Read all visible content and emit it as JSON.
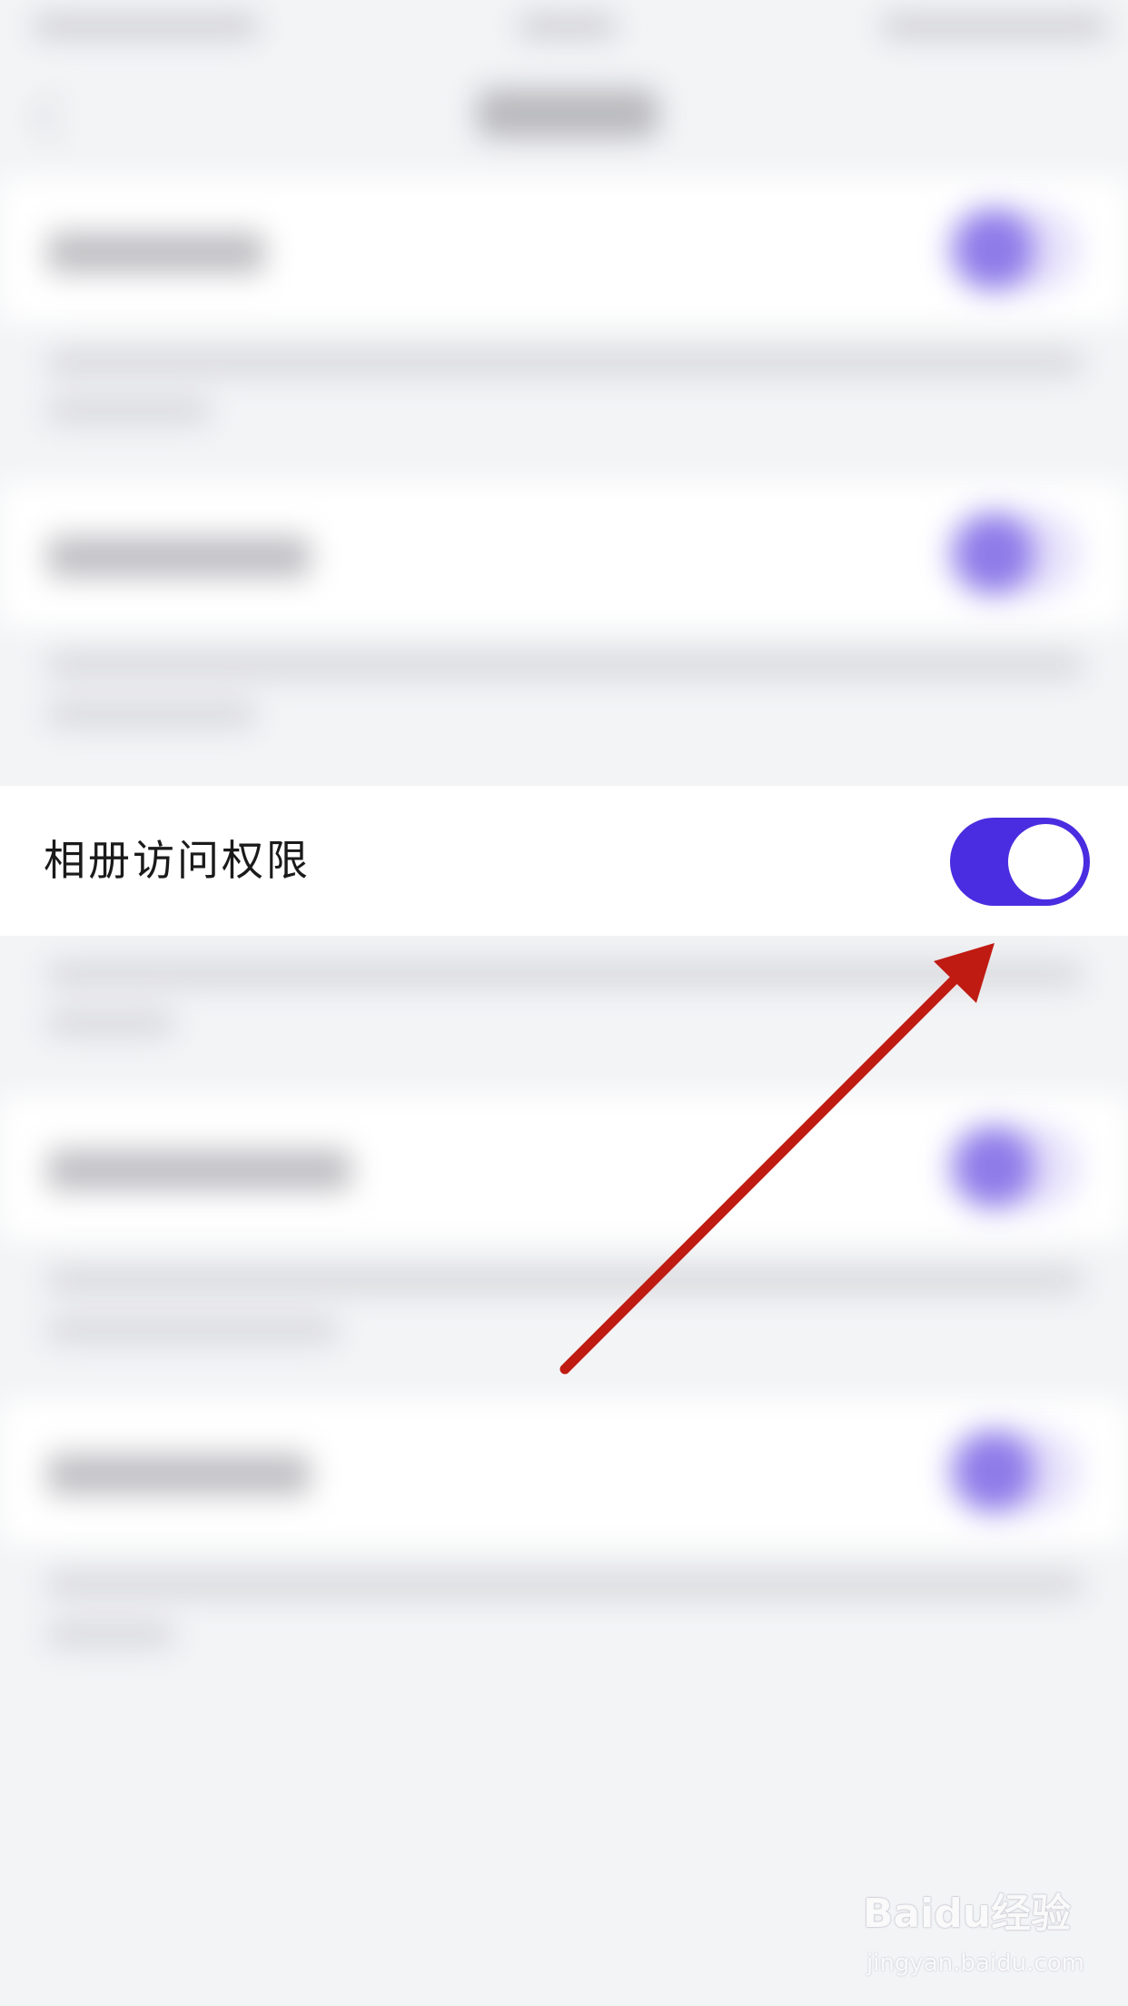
{
  "settings": {
    "active_item_label": "相册访问权限",
    "active_item_toggle_on": true
  },
  "colors": {
    "accent": "#4a2de0",
    "annotation_arrow": "#c01b12"
  },
  "watermark": {
    "logo": "Baidu经验",
    "url": "jingyan.baidu.com"
  },
  "icons": {
    "back": "chevron-left-icon",
    "annotation": "arrow-annotation-icon"
  }
}
